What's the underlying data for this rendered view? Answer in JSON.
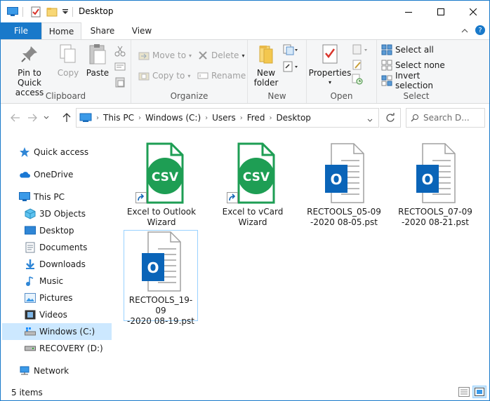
{
  "window": {
    "title": "Desktop"
  },
  "tabs": {
    "file": "File",
    "home": "Home",
    "share": "Share",
    "view": "View"
  },
  "ribbon": {
    "clipboard": {
      "label": "Clipboard",
      "pin": "Pin to Quick access",
      "copy": "Copy",
      "paste": "Paste"
    },
    "organize": {
      "label": "Organize",
      "move_to": "Move to",
      "copy_to": "Copy to",
      "delete": "Delete",
      "rename": "Rename"
    },
    "new": {
      "label": "New",
      "new_folder": "New folder"
    },
    "open": {
      "label": "Open",
      "properties": "Properties"
    },
    "select": {
      "label": "Select",
      "select_all": "Select all",
      "select_none": "Select none",
      "invert": "Invert selection"
    }
  },
  "address": {
    "crumbs": [
      "This PC",
      "Windows (C:)",
      "Users",
      "Fred",
      "Desktop"
    ],
    "search_placeholder": "Search D..."
  },
  "navpane": {
    "quick_access": "Quick access",
    "onedrive": "OneDrive",
    "this_pc": "This PC",
    "objects3d": "3D Objects",
    "desktop": "Desktop",
    "documents": "Documents",
    "downloads": "Downloads",
    "music": "Music",
    "pictures": "Pictures",
    "videos": "Videos",
    "windows_c": "Windows (C:)",
    "recovery_d": "RECOVERY (D:)",
    "network": "Network"
  },
  "files": [
    {
      "name1": "Excel to Outlook",
      "name2": "Wizard",
      "type": "csv-shortcut"
    },
    {
      "name1": "Excel to vCard",
      "name2": "Wizard",
      "type": "csv-shortcut"
    },
    {
      "name1": "RECTOOLS_05-09",
      "name2": "-2020 08-05.pst",
      "type": "pst"
    },
    {
      "name1": "RECTOOLS_07-09",
      "name2": "-2020 08-21.pst",
      "type": "pst"
    },
    {
      "name1": "RECTOOLS_19-09",
      "name2": "-2020 08-19.pst",
      "type": "pst"
    }
  ],
  "status": {
    "items": "5 items"
  },
  "colors": {
    "accent": "#1979ca",
    "csv_green": "#1e9e54",
    "outlook_blue": "#0a64b8",
    "selected": "#cce8ff"
  }
}
